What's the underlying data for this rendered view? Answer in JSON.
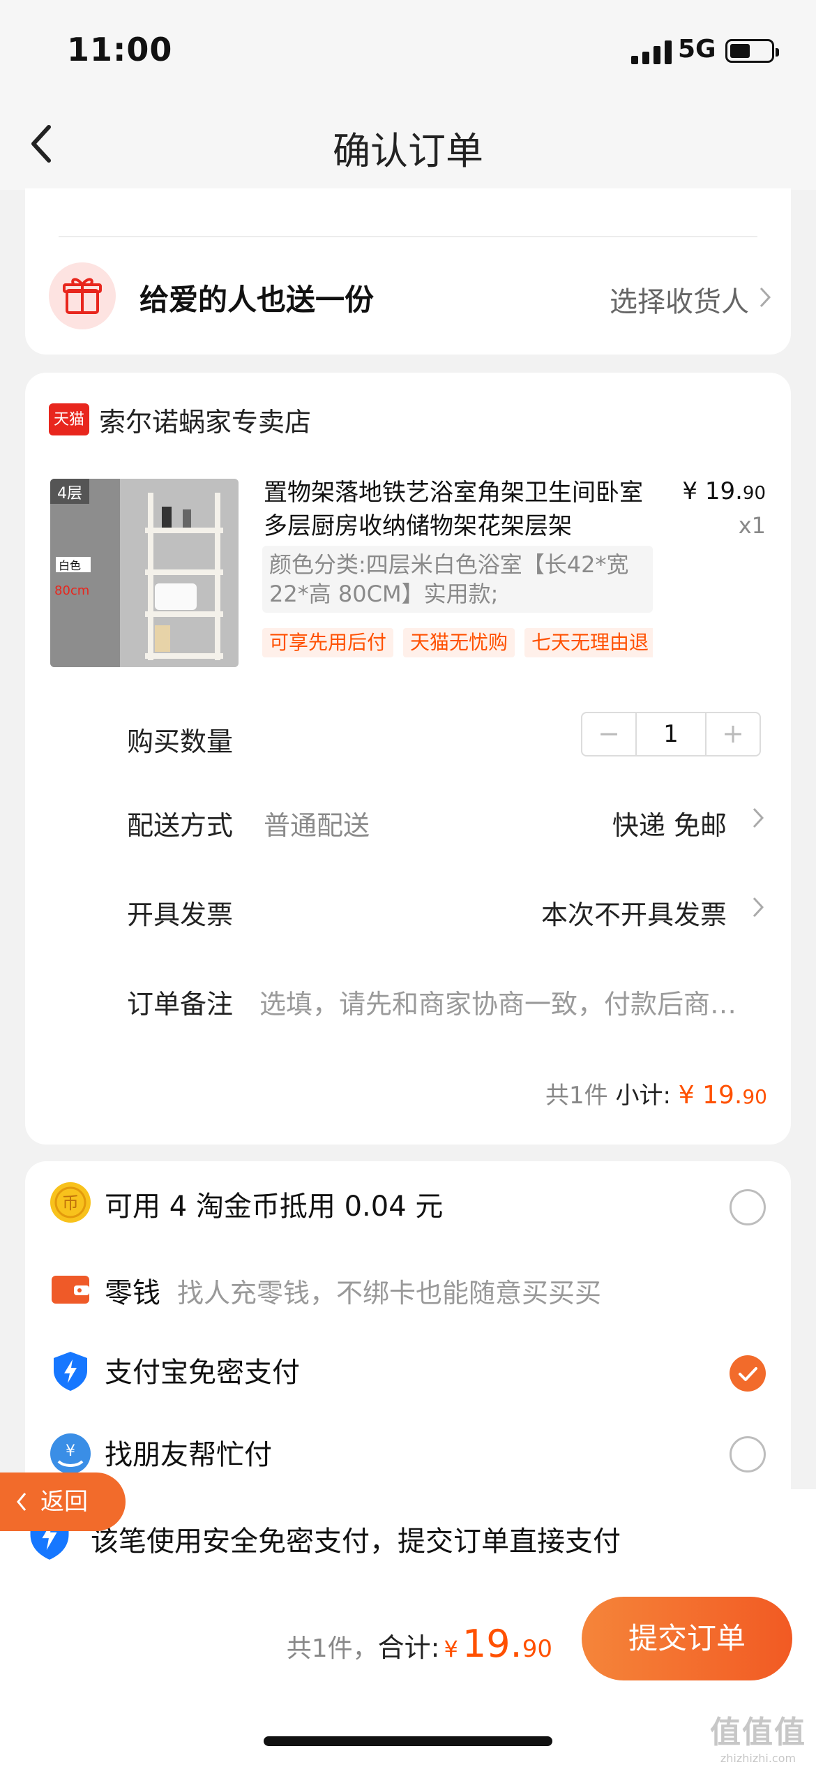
{
  "status_bar": {
    "time": "11:00",
    "network": "5G"
  },
  "header": {
    "title": "确认订单"
  },
  "gift": {
    "label": "给爱的人也送一份",
    "action": "选择收货人"
  },
  "store": {
    "badge": "天猫",
    "name": "索尔诺蜗家专卖店"
  },
  "product": {
    "title": "置物架落地铁艺浴室角架卫生间卧室多层厨房收纳储物架花架层架",
    "price_yen": "¥ ",
    "price_int": "19.",
    "price_cents": "90",
    "quantity_label": "x1",
    "sku": "颜色分类:四层米白色浴室【长42*宽 22*高 80CM】实用款;",
    "tags": [
      "可享先用后付",
      "天猫无忧购",
      "七天无理由退"
    ],
    "image_labels": {
      "top": "4层",
      "color": "白色",
      "height": "80cm"
    }
  },
  "quantity": {
    "label": "购买数量",
    "minus": "−",
    "value": "1",
    "plus": "+"
  },
  "shipping": {
    "label": "配送方式",
    "method": "普通配送",
    "value": "快递 免邮"
  },
  "invoice": {
    "label": "开具发票",
    "value": "本次不开具发票"
  },
  "note": {
    "label": "订单备注",
    "placeholder": "选填，请先和商家协商一致，付款后商家可见"
  },
  "subtotal": {
    "count": "共1件 ",
    "label": "小计: ",
    "yen": "¥ ",
    "int": "19.",
    "cents": "90"
  },
  "payment": {
    "coins": {
      "label": "可用 4 淘金币抵用 0.04 元",
      "icon": "coin-icon",
      "selected": false
    },
    "change": {
      "label": "零钱",
      "sub": "找人充零钱，不绑卡也能随意买买买",
      "icon": "wallet-icon"
    },
    "alipay": {
      "label": "支付宝免密支付",
      "icon": "shield-lightning-icon",
      "selected": true
    },
    "friend": {
      "label": "找朋友帮忙付",
      "icon": "friend-pay-icon",
      "selected": false
    }
  },
  "notice": {
    "text": "该笔使用安全免密支付，提交订单直接支付"
  },
  "back_button": {
    "label": "返回"
  },
  "footer": {
    "count": "共1件，",
    "total_label": "合计:",
    "yen": "¥",
    "total_int": "19.",
    "total_cents": "90",
    "submit": "提交订单"
  },
  "watermark": {
    "main": "值值值",
    "sub": "zhizhizhi.com"
  },
  "colors": {
    "accent": "#ff5000",
    "button": "#f26b2b",
    "tmall_red": "#e8261d",
    "alipay_blue": "#1677ff"
  }
}
